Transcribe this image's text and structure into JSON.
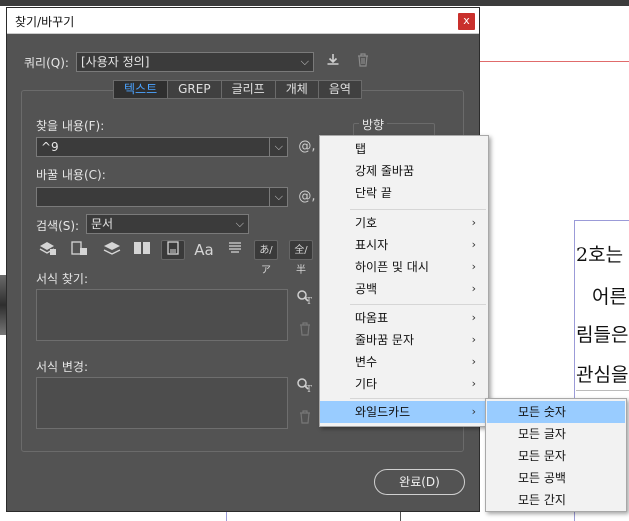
{
  "document": {
    "lines": [
      "2호는",
      "어른",
      "림들은",
      "관심을"
    ]
  },
  "dialog": {
    "title": "찾기/바꾸기",
    "close_label": "x",
    "query_label": "쿼리(Q):",
    "query_value": "[사용자 정의]",
    "tabs": [
      {
        "label": "텍스트",
        "active": true
      },
      {
        "label": "GREP",
        "active": false
      },
      {
        "label": "글리프",
        "active": false
      },
      {
        "label": "개체",
        "active": false
      },
      {
        "label": "음역",
        "active": false
      }
    ],
    "find_label": "찾을 내용(F):",
    "find_value": "^9",
    "replace_label": "바꿀 내용(C):",
    "replace_value": "",
    "search_label": "검색(S):",
    "search_value": "문서",
    "direction_label": "방향",
    "find_format_label": "서식 찾기:",
    "replace_format_label": "서식 변경:",
    "special_char_icon": "@,",
    "option_icons": [
      "lock-layers-icon",
      "lock-stories-icon",
      "hidden-layers-icon",
      "master-pages-icon",
      "footnotes-icon",
      "case-sensitive-icon",
      "whole-word-icon",
      "kana-sensitive-icon",
      "full-half-width-icon"
    ],
    "option_texts": {
      "case": "Aa",
      "kana": "あ/ア",
      "width": "全/半"
    },
    "done_label": "완료(D)",
    "accent_color": "#4ba3ff"
  },
  "menu": {
    "items": [
      {
        "label": "탭",
        "submenu": false
      },
      {
        "label": "강제 줄바꿈",
        "submenu": false
      },
      {
        "label": "단락 끝",
        "submenu": false
      },
      {
        "label": "기호",
        "submenu": true
      },
      {
        "label": "표시자",
        "submenu": true
      },
      {
        "label": "하이픈 및 대시",
        "submenu": true
      },
      {
        "label": "공백",
        "submenu": true
      },
      {
        "label": "따옴표",
        "submenu": true
      },
      {
        "label": "줄바꿈 문자",
        "submenu": true
      },
      {
        "label": "변수",
        "submenu": true
      },
      {
        "label": "기타",
        "submenu": true
      },
      {
        "label": "와일드카드",
        "submenu": true,
        "highlighted": true
      }
    ],
    "submenu_arrow": "›",
    "highlight_color": "#99ccff"
  },
  "submenu": {
    "items": [
      {
        "label": "모든 숫자",
        "highlighted": true
      },
      {
        "label": "모든 글자"
      },
      {
        "label": "모든 문자"
      },
      {
        "label": "모든 공백"
      },
      {
        "label": "모든 간지"
      }
    ]
  }
}
